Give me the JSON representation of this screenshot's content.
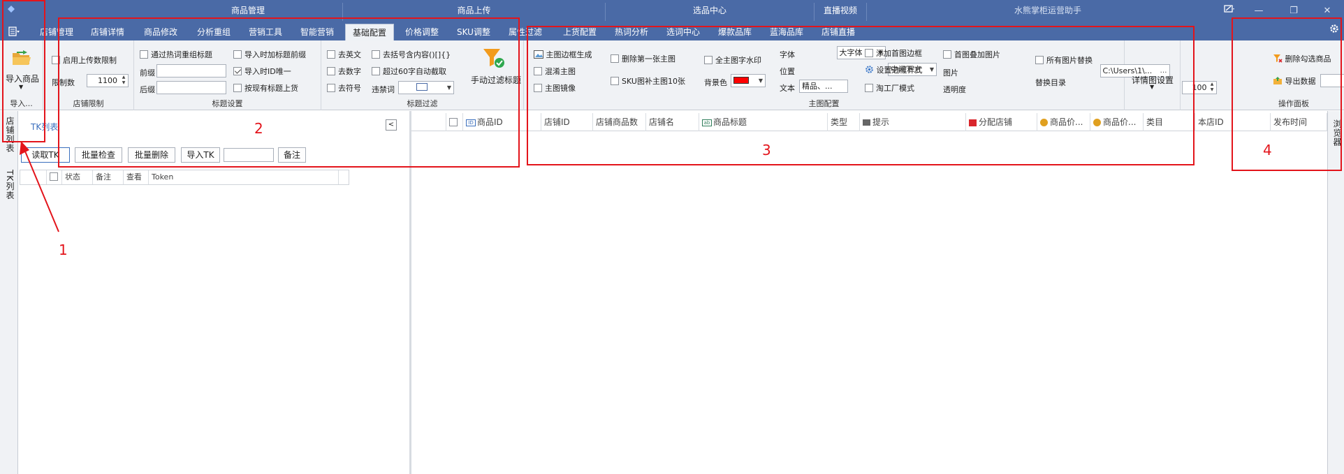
{
  "header": {
    "groups": [
      "商品管理",
      "商品上传",
      "选品中心",
      "直播视频"
    ],
    "app_title": "水熊掌柜运营助手",
    "tabs": [
      "店铺管理",
      "店铺详情",
      "商品修改",
      "分析重组",
      "营销工具",
      "智能营销",
      "基础配置",
      "价格调整",
      "SKU调整",
      "属性过滤",
      "上货配置",
      "热词分析",
      "选词中心",
      "爆款品库",
      "蓝海品库",
      "店铺直播"
    ],
    "active_tab": "基础配置"
  },
  "ribbon": {
    "import": {
      "button": "导入商品",
      "group": "导入..."
    },
    "shop_limit": {
      "enable": "启用上传数限制",
      "limit_label": "限制数",
      "limit_value": "1100",
      "group": "店铺限制"
    },
    "title_settings": {
      "hotword": "通过热词重组标题",
      "prefix_label": "前缀",
      "suffix_label": "后缀",
      "add_prefix": "导入时加标题前缀",
      "unique_id": "导入时ID唯一",
      "by_title": "按现有标题上货",
      "group": "标题设置"
    },
    "title_filter": {
      "remove_english": "去英文",
      "remove_number": "去数字",
      "remove_symbol": "去符号",
      "remove_bracket": "去括号含内容()[]{}",
      "truncate60": "超过60字自动截取",
      "banned_label": "违禁词",
      "manual_filter": "手动过滤标题",
      "group": "标题过滤"
    },
    "main_image": {
      "border_gen": "主图边框生成",
      "shuffle": "混淆主图",
      "mirror": "主图镜像",
      "delete_first": "删除第一张主图",
      "sku_fill": "SKU图补主图10张",
      "watermark": "全主图字水印",
      "bg_color_label": "背景色",
      "bg_color": "#ff0000",
      "font_label": "字体",
      "font_value": "大字体",
      "position_label": "位置",
      "position_value": "中间下方",
      "text_label": "文本",
      "text_value": "精品、...",
      "add_border": "添加首图边框",
      "border_style": "设置边框样式",
      "taobao_mode": "淘工厂模式",
      "overlay": "首图叠加图片",
      "image_label": "图片",
      "image_path": "C:\\Users\\1\\...",
      "opacity_label": "透明度",
      "opacity_value": "100",
      "replace_all": "所有图片替换",
      "replace_dir_label": "替换目录",
      "group": "主图配置"
    },
    "detail": {
      "button": "详情图设置"
    },
    "ops": {
      "delete_checked": "删除勾选商品",
      "export": "导出数据",
      "group": "操作面板"
    }
  },
  "left_rail": {
    "tab1": "店铺列表",
    "tab2": "TK列表"
  },
  "left_panel": {
    "title": "TK列表",
    "buttons": [
      "读取TK",
      "批量检查",
      "批量删除",
      "导入TK",
      "备注"
    ],
    "columns": [
      "状态",
      "备注",
      "查看",
      "Token"
    ]
  },
  "main_grid": {
    "columns": [
      "商品ID",
      "店铺ID",
      "店铺商品数",
      "店铺名",
      "商品标题",
      "类型",
      "提示",
      "分配店铺",
      "商品价...",
      "商品价...",
      "类目",
      "本店ID",
      "发布时间"
    ]
  },
  "right_rail": {
    "tab": "浏览器"
  },
  "annotations": [
    "1",
    "2",
    "3",
    "4"
  ]
}
